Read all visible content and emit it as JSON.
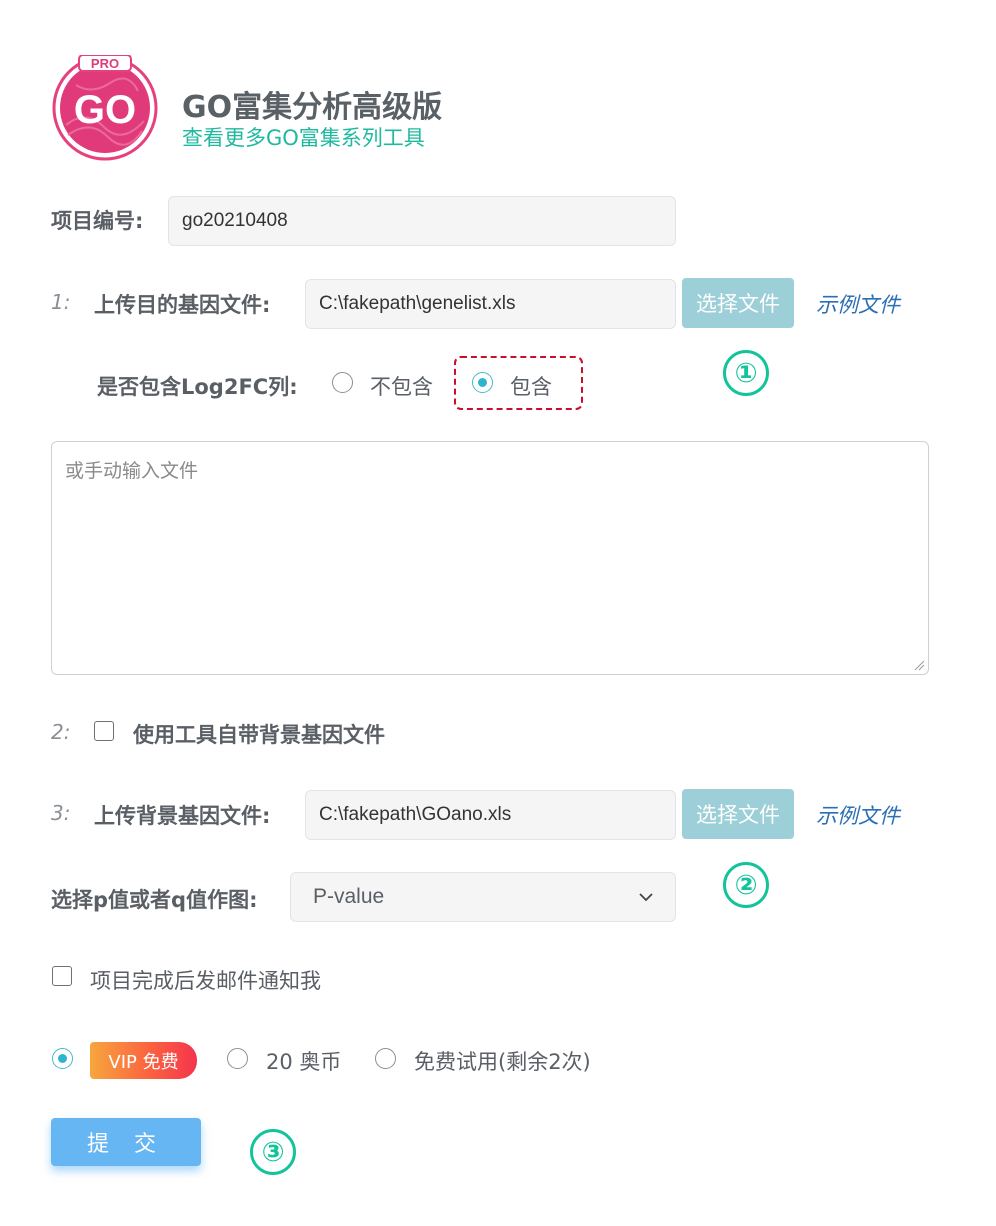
{
  "header": {
    "logo_badge": "PRO",
    "logo_mark": "GO",
    "title": "GO富集分析高级版",
    "subtitle": "查看更多GO富集系列工具"
  },
  "project": {
    "label": "项目编号:",
    "value": "go20210408"
  },
  "step1": {
    "num": "1:",
    "label": "上传目的基因文件:",
    "file_value": "C:\\fakepath\\genelist.xls",
    "choose_button": "选择文件",
    "example_link": "示例文件",
    "log2fc_label": "是否包含Log2FC列:",
    "options": [
      "不包含",
      "包含"
    ],
    "selected_option": "包含",
    "textarea_placeholder": "或手动输入文件"
  },
  "step2": {
    "num": "2:",
    "label": "使用工具自带背景基因文件",
    "checked": false
  },
  "step3": {
    "num": "3:",
    "label": "上传背景基因文件:",
    "file_value": "C:\\fakepath\\GOano.xls",
    "choose_button": "选择文件",
    "example_link": "示例文件"
  },
  "plot_value": {
    "label": "选择p值或者q值作图:",
    "selected": "P-value"
  },
  "email_notify": {
    "label": "项目完成后发邮件通知我",
    "checked": false
  },
  "payment": {
    "vip_label": "VIP 免费",
    "coin_label": "20 奥币",
    "trial_label": "免费试用(剩余2次)",
    "selected": "vip"
  },
  "submit_label": "提 交",
  "annotations": [
    "①",
    "②",
    "③"
  ],
  "colors": {
    "accent_teal": "#13c49a",
    "file_button": "#9ccfd8",
    "submit": "#66b6f4",
    "link": "#2b6fb5",
    "highlight_dash": "#c8102e",
    "logo_pink": "#e03a7a"
  }
}
